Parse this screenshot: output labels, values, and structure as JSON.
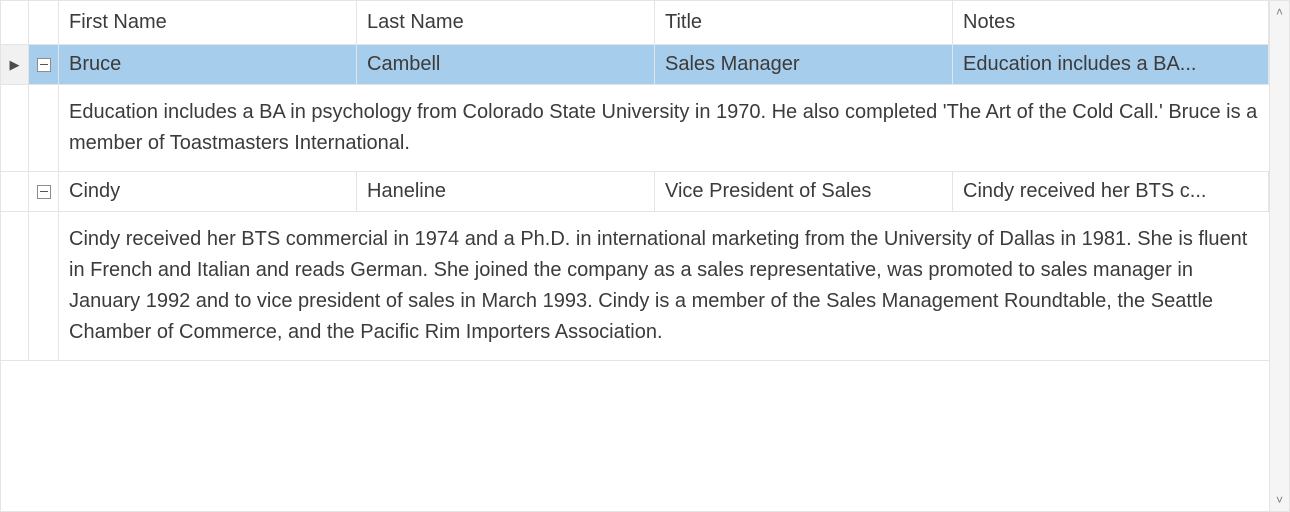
{
  "columns": {
    "first_name": "First Name",
    "last_name": "Last Name",
    "title": "Title",
    "notes": "Notes"
  },
  "rows": [
    {
      "first_name": "Bruce",
      "last_name": "Cambell",
      "title": "Sales Manager",
      "notes_short": "Education includes a BA...",
      "notes_full": "Education includes a BA in psychology from Colorado State University in 1970.  He also completed 'The Art of the Cold Call.'  Bruce is a member of Toastmasters International.",
      "selected": true,
      "expanded": true
    },
    {
      "first_name": "Cindy",
      "last_name": "Haneline",
      "title": "Vice President of Sales",
      "notes_short": "Cindy received her BTS c...",
      "notes_full": "Cindy received her BTS commercial in 1974 and a Ph.D. in international marketing from the University of Dallas in 1981.  She is fluent in French and Italian and reads German.  She joined the company as a sales representative, was promoted to sales manager in January 1992 and to vice president of sales in March 1993.  Cindy is a member of the Sales Management Roundtable, the Seattle Chamber of Commerce, and the Pacific Rim Importers Association.",
      "selected": false,
      "expanded": true
    }
  ],
  "colors": {
    "selection": "#a6cdec",
    "border": "#e4e4e4"
  }
}
